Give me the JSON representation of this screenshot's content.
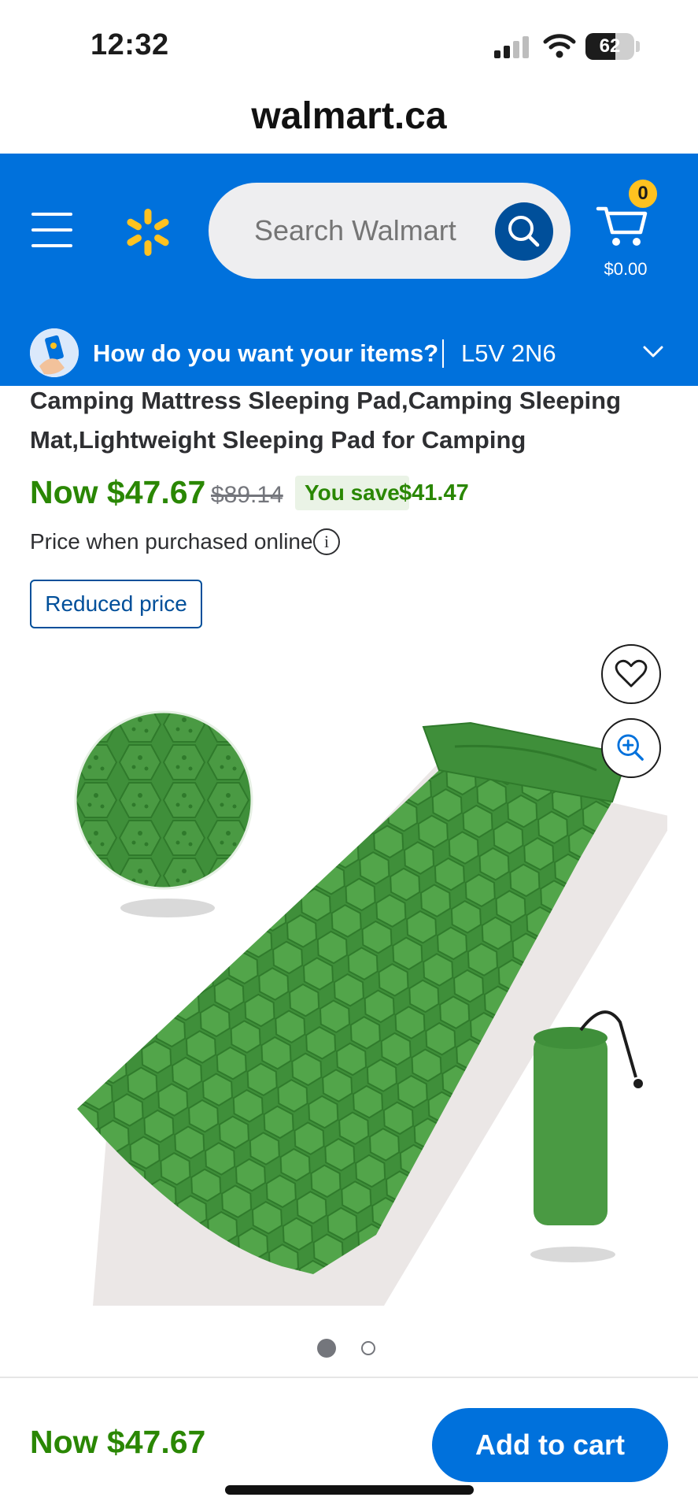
{
  "status_bar": {
    "time": "12:32",
    "battery_level": "62",
    "icons": [
      "signal-icon",
      "wifi-icon",
      "battery-icon"
    ]
  },
  "browser": {
    "url": "walmart.ca"
  },
  "header": {
    "search_placeholder": "Search Walmart",
    "cart_count": "0",
    "cart_total": "$0.00",
    "brand_color": "#0071dc",
    "spark_color": "#ffc220",
    "icons": [
      "menu-icon",
      "walmart-spark-icon",
      "search-icon",
      "cart-icon"
    ]
  },
  "delivery": {
    "prompt": "How do you want your items?",
    "postal_code": "L5V 2N6",
    "icons": [
      "delivery-avatar-icon",
      "chevron-down-icon"
    ]
  },
  "product": {
    "title": "Camping Mattress Sleeping Pad,Camping Sleeping Mat,Lightweight Sleeping Pad for Camping",
    "price_now": "Now $47.67",
    "price_was": "$89.14",
    "you_save_label": "You save",
    "save_amount": "$41.47",
    "price_note": "Price when purchased online",
    "badge": "Reduced price",
    "price_color": "#2a8703",
    "image_color": "#3f8f3a"
  },
  "gallery": {
    "icons": [
      "heart-icon",
      "zoom-in-icon"
    ],
    "current_image": 1,
    "image_count": 2
  },
  "footer": {
    "price": "Now $47.67",
    "add_to_cart": "Add to cart"
  }
}
